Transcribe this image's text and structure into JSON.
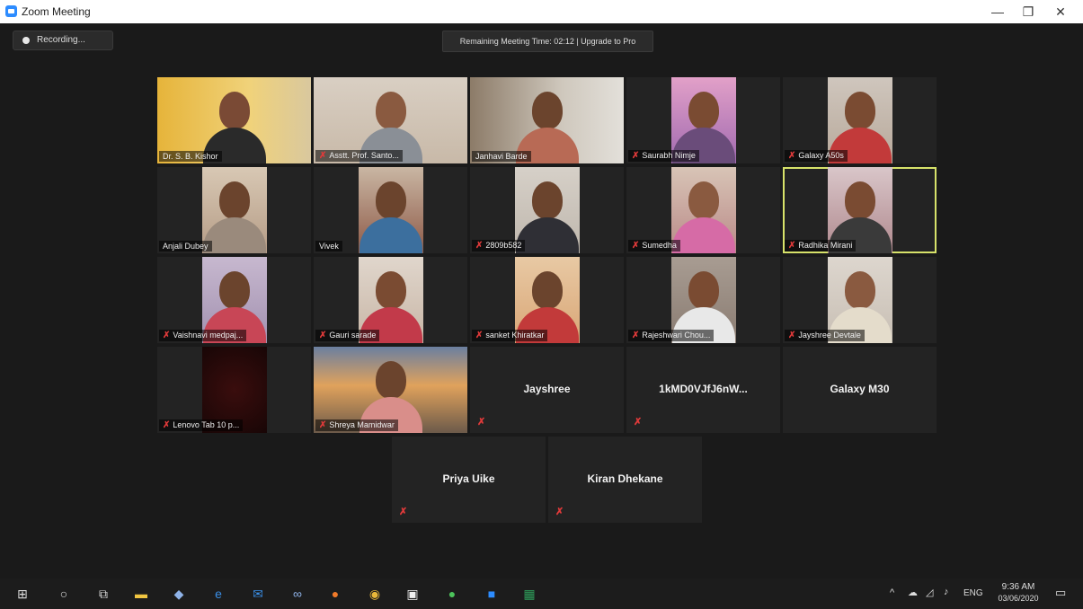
{
  "window": {
    "title": "Zoom Meeting"
  },
  "recording": {
    "label": "Recording..."
  },
  "timer": {
    "text": "Remaining Meeting Time: 02:12 | Upgrade to Pro"
  },
  "participants": [
    "Dr. S. B. Kishor",
    "Asstt. Prof. Santo...",
    "Janhavi Barde",
    "Saurabh Nimje",
    "Galaxy A50s",
    "Anjali Dubey",
    "Vivek",
    "2809b582",
    "Sumedha",
    "Radhika Mirani",
    "Vaishnavi medpaj...",
    "Gauri sarade",
    "sanket Khiratkar",
    "Rajeshwari Chou...",
    "Jayshree Devtale",
    "Lenovo Tab 10 p...",
    "Shreya Mamidwar",
    "Jayshree",
    "1kMD0VJfJ6nW...",
    "Galaxy M30",
    "Priya Uike",
    "Kiran Dhekane"
  ],
  "taskbar": {
    "tray_lang": "ENG",
    "time": "9:36 AM",
    "date": "03/06/2020",
    "icons": [
      "windows-start-icon",
      "search-icon",
      "task-view-icon",
      "file-explorer-icon",
      "paint-icon",
      "edge-icon",
      "mail-icon",
      "link-icon",
      "firefox-icon",
      "chrome-icon",
      "store-icon",
      "whatsapp-icon",
      "zoom-icon",
      "excel-icon"
    ]
  }
}
